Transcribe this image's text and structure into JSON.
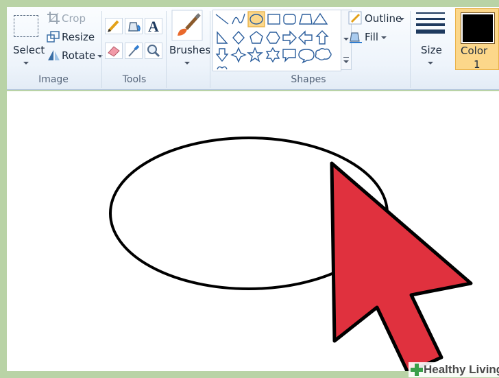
{
  "ribbon": {
    "image_group": {
      "label": "Image",
      "select_label": "Select",
      "crop_label": "Crop",
      "resize_label": "Resize",
      "rotate_label": "Rotate"
    },
    "tools_group": {
      "label": "Tools",
      "tools": [
        "pencil-icon",
        "fill-bucket-icon",
        "text-icon",
        "eraser-icon",
        "color-picker-icon",
        "magnifier-icon"
      ],
      "text_tool_glyph": "A"
    },
    "brushes": {
      "label": "Brushes"
    },
    "shapes_group": {
      "label": "Shapes",
      "selected_shape": "oval",
      "outline_label": "Outline",
      "fill_label": "Fill"
    },
    "size": {
      "label": "Size"
    },
    "color1": {
      "label_line1": "Color",
      "label_line2": "1",
      "color": "#000000"
    }
  },
  "canvas": {
    "background": "#ffffff",
    "shape": "ellipse",
    "stroke_color": "#000000",
    "pointer_color": "#e0313e"
  },
  "watermark": {
    "text": "Healthy Living"
  },
  "colors": {
    "accent_selected": "#fcd78a",
    "ribbon_bg": "#eef4fb"
  }
}
